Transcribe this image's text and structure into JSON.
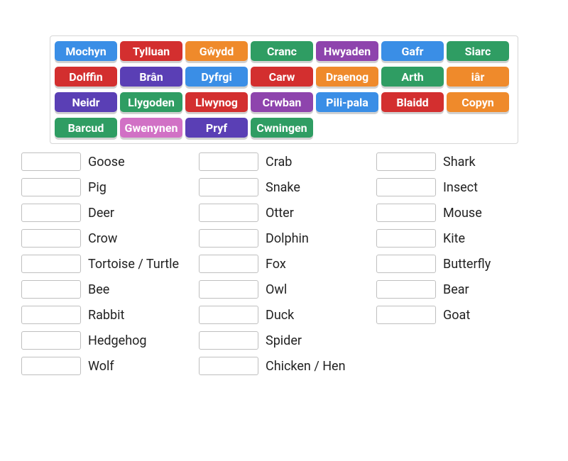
{
  "bank": {
    "chips": [
      {
        "label": "Mochyn",
        "color": "c-blue"
      },
      {
        "label": "Tylluan",
        "color": "c-red"
      },
      {
        "label": "Gŵydd",
        "color": "c-orange"
      },
      {
        "label": "Cranc",
        "color": "c-green"
      },
      {
        "label": "Hwyaden",
        "color": "c-purple"
      },
      {
        "label": "Gafr",
        "color": "c-blue"
      },
      {
        "label": "Siarc",
        "color": "c-green"
      },
      {
        "label": "Dolffin",
        "color": "c-red"
      },
      {
        "label": "Brân",
        "color": "c-violet"
      },
      {
        "label": "Dyfrgi",
        "color": "c-blue"
      },
      {
        "label": "Carw",
        "color": "c-red"
      },
      {
        "label": "Draenog",
        "color": "c-orange"
      },
      {
        "label": "Arth",
        "color": "c-green"
      },
      {
        "label": "iâr",
        "color": "c-orange"
      },
      {
        "label": "Neidr",
        "color": "c-violet"
      },
      {
        "label": "Llygoden",
        "color": "c-green"
      },
      {
        "label": "Llwynog",
        "color": "c-red"
      },
      {
        "label": "Crwban",
        "color": "c-purple"
      },
      {
        "label": "Pili-pala",
        "color": "c-blue"
      },
      {
        "label": "Blaidd",
        "color": "c-red"
      },
      {
        "label": "Copyn",
        "color": "c-orange"
      },
      {
        "label": "Barcud",
        "color": "c-green"
      },
      {
        "label": "Gwenynen",
        "color": "c-magenta"
      },
      {
        "label": "Pryf",
        "color": "c-violet"
      },
      {
        "label": "Cwningen",
        "color": "c-green"
      }
    ]
  },
  "answers": {
    "col1": [
      {
        "label": "Goose"
      },
      {
        "label": "Pig"
      },
      {
        "label": "Deer"
      },
      {
        "label": "Crow"
      },
      {
        "label": "Tortoise / Turtle"
      },
      {
        "label": "Bee"
      },
      {
        "label": "Rabbit"
      },
      {
        "label": "Hedgehog"
      },
      {
        "label": "Wolf"
      }
    ],
    "col2": [
      {
        "label": "Crab"
      },
      {
        "label": "Snake"
      },
      {
        "label": "Otter"
      },
      {
        "label": "Dolphin"
      },
      {
        "label": "Fox"
      },
      {
        "label": "Owl"
      },
      {
        "label": "Duck"
      },
      {
        "label": "Spider"
      },
      {
        "label": "Chicken / Hen"
      }
    ],
    "col3": [
      {
        "label": "Shark"
      },
      {
        "label": "Insect"
      },
      {
        "label": "Mouse"
      },
      {
        "label": "Kite"
      },
      {
        "label": "Butterfly"
      },
      {
        "label": "Bear"
      },
      {
        "label": "Goat"
      }
    ]
  }
}
